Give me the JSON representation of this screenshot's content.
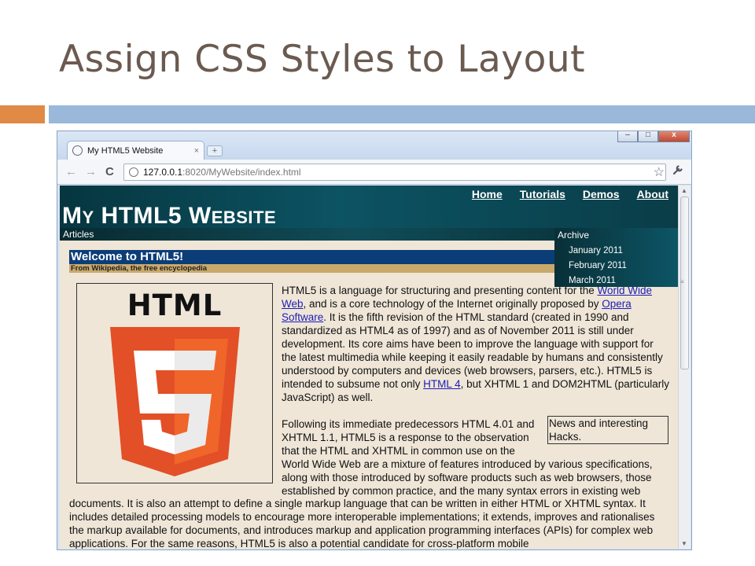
{
  "slide": {
    "title": "Assign CSS Styles to Layout",
    "colors": {
      "title": "#6b5a50",
      "accent_orange": "#e08a46",
      "accent_blue": "#9ab8d9"
    }
  },
  "browser": {
    "tab_title": "My HTML5 Website",
    "tab_close": "×",
    "new_tab": "+",
    "window_controls": [
      "–",
      "□",
      "x"
    ],
    "url_host": "127.0.0.1",
    "url_rest": ":8020/MyWebsite/index.html",
    "icons": {
      "back": "←",
      "forward": "→",
      "reload": "C",
      "star": "☆",
      "wrench": "🔧"
    }
  },
  "site": {
    "logo_first_big": "M",
    "logo_first_small": "Y",
    "logo_mid": " HTML5 ",
    "logo_second_big": "W",
    "logo_second_small": "EBSITE",
    "nav": [
      "Home",
      "Tutorials",
      "Demos",
      "About"
    ],
    "articles_label": "Articles",
    "archive": {
      "title": "Archive",
      "items": [
        "January 2011",
        "February 2011",
        "March 2011"
      ]
    },
    "colors": {
      "header": "#0c5363",
      "welcome_bg": "#0b3d78",
      "sub_bg": "#c9a96b",
      "page_bg": "#efe6d8",
      "link": "#1d1db5"
    }
  },
  "article": {
    "heading": "Welcome to HTML5!",
    "subheading": "From Wikipedia, the free encyclopedia",
    "logo_text": "HTML",
    "logo_number": "5",
    "p1": {
      "t1": "HTML5 is a language for structuring and presenting content for the ",
      "link1": "World Wide Web",
      "t2": ", and is a core technology of the Internet originally proposed by ",
      "link2": "Opera Software",
      "t3": ". It is the fifth revision of the HTML standard (created in 1990 and standardized as HTML4 as of 1997) and as of November 2011 is still under development. Its core aims have been to improve the language with support for the latest multimedia while keeping it easily readable by humans and consistently understood by computers and devices (web browsers, parsers, etc.). HTML5 is intended to subsume not only ",
      "link3": "HTML 4",
      "t4": ", but XHTML 1 and DOM2HTML (particularly JavaScript) as well."
    },
    "p2_lines": [
      "Following its immediate predecessors HTML 4.01 and",
      "XHTML 1.1, HTML5 is a response to the observation",
      "that the HTML and XHTML in common use on the",
      "World Wide Web are a mixture of features introduced by various specifications,",
      "along with those introduced by software products such as web browsers, those",
      "established by common practice, and the many syntax errors in existing web"
    ],
    "p2_rest": "documents. It is also an attempt to define a single markup language that can be written in either HTML or XHTML syntax. It includes detailed processing models to encourage more interoperable implementations; it extends, improves and rationalises the markup available for documents, and introduces markup and application programming interfaces (APIs) for complex web applications. For the same reasons, HTML5 is also a potential candidate for cross-platform mobile",
    "news_box": "News and interesting Hacks."
  }
}
